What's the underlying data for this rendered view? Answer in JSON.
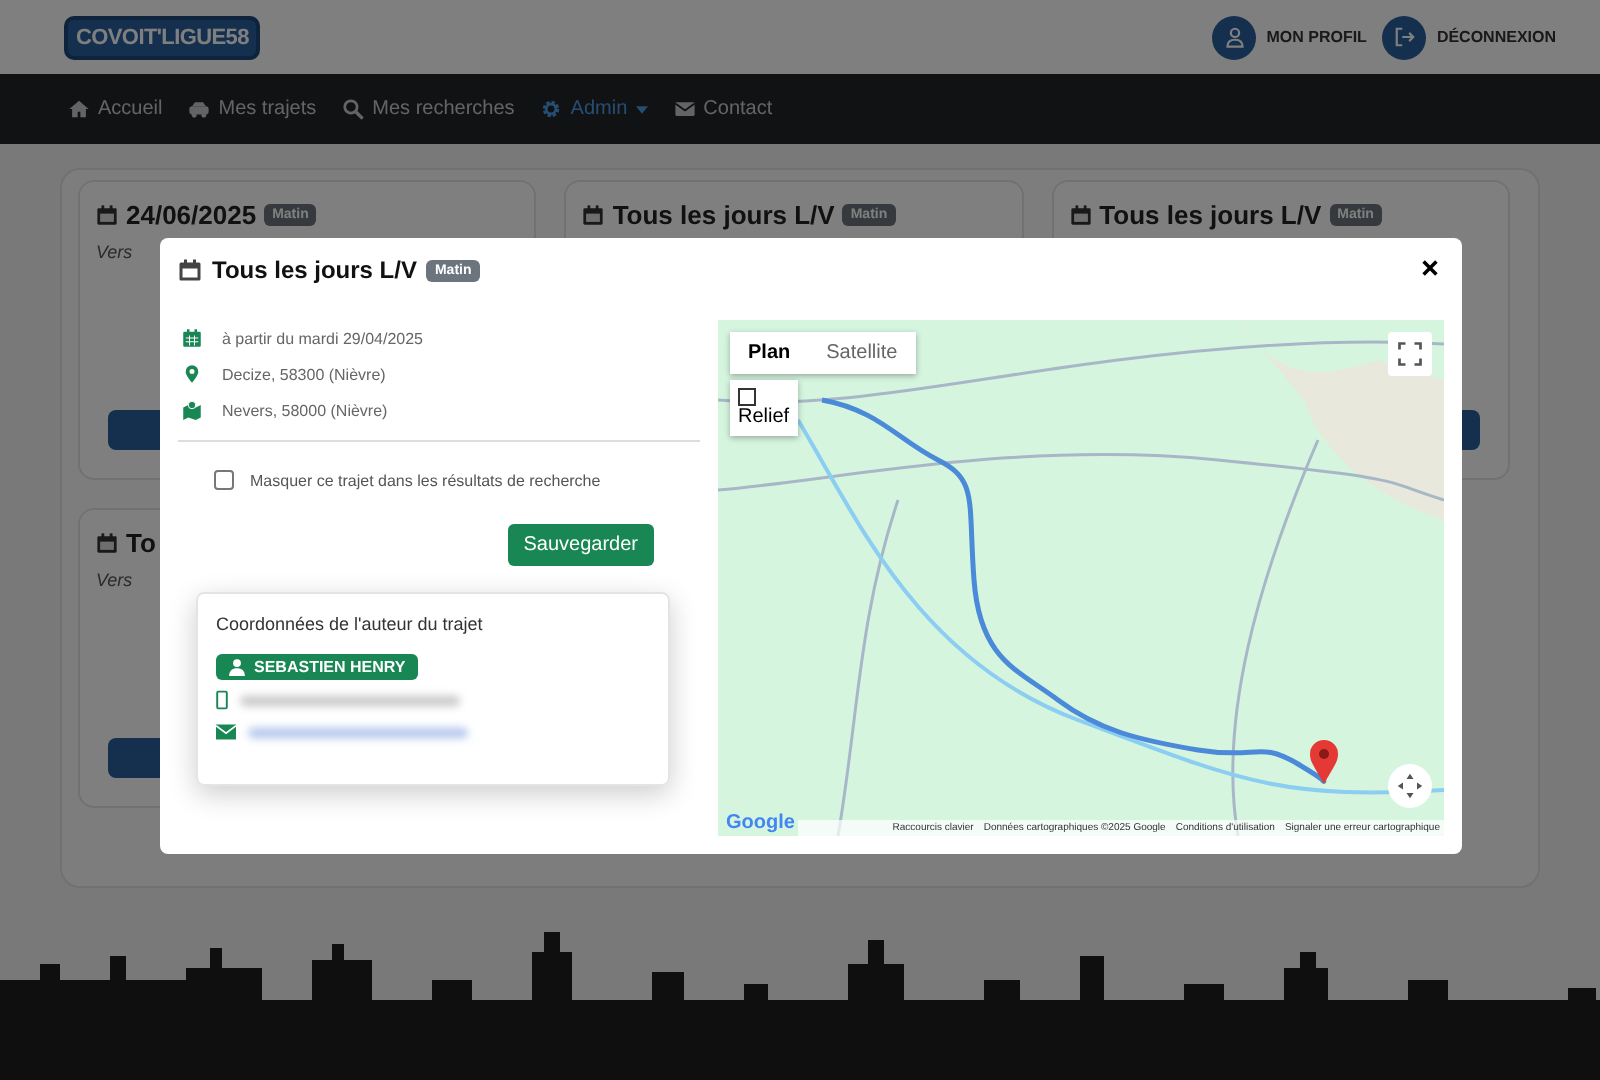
{
  "header": {
    "logo": "COVOIT'LIGUE58",
    "actions": [
      {
        "label": "MON PROFIL"
      },
      {
        "label": "DÉCONNEXION"
      }
    ]
  },
  "nav": [
    {
      "label": "Accueil",
      "selected": false,
      "dropdown": false
    },
    {
      "label": "Mes trajets",
      "selected": false,
      "dropdown": false
    },
    {
      "label": "Mes recherches",
      "selected": false,
      "dropdown": false
    },
    {
      "label": "Admin",
      "selected": true,
      "dropdown": true
    },
    {
      "label": "Contact",
      "selected": false,
      "dropdown": false
    }
  ],
  "cards": [
    {
      "title": "24/06/2025",
      "badge": "Matin",
      "subtitle": "Vers"
    },
    {
      "title": "Tous les jours L/V",
      "badge": "Matin"
    },
    {
      "title": "Tous les jours L/V",
      "badge": "Matin"
    },
    {
      "title": "To",
      "subtitle": "Vers"
    }
  ],
  "modal": {
    "title": "Tous les jours L/V",
    "badge": "Matin",
    "details": [
      {
        "kind": "date",
        "text": "à partir du mardi 29/04/2025"
      },
      {
        "kind": "start",
        "text": "Decize, 58300 (Nièvre)"
      },
      {
        "kind": "destination",
        "text": "Nevers, 58000 (Nièvre)"
      }
    ],
    "hide_option": {
      "label": "Masquer ce trajet dans les résultats de recherche",
      "checked": false
    },
    "save_button": "Sauvegarder",
    "author": {
      "heading": "Coordonnées de l'auteur du trajet",
      "name": "SEBASTIEN HENRY"
    },
    "map": {
      "map_types": [
        {
          "label": "Plan",
          "selected": true
        },
        {
          "label": "Satellite",
          "selected": false
        }
      ],
      "relief": {
        "label": "Relief",
        "checked": false
      },
      "logo": "Google",
      "attribution": [
        "Raccourcis clavier",
        "Données cartographiques ©2025 Google",
        "Conditions d'utilisation",
        "Signaler une erreur cartographique"
      ]
    }
  }
}
